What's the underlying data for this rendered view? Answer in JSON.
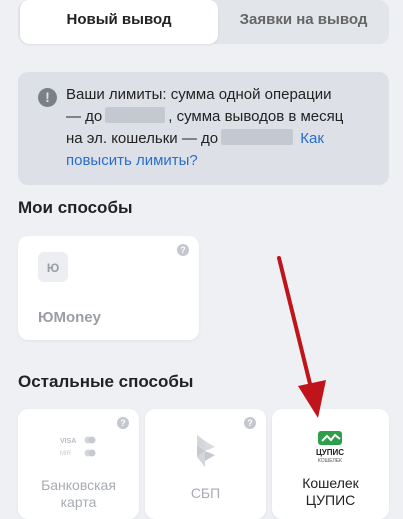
{
  "tabs": [
    {
      "label": "Новый вывод",
      "active": true
    },
    {
      "label": "Заявки на вывод",
      "active": false
    }
  ],
  "limits": {
    "icon": "info-icon",
    "line1": "Ваши лимиты: сумма одной операции",
    "line2_prefix": "— до",
    "line2_suffix": ", сумма выводов в месяц",
    "line3_prefix": "на эл. кошельки — до",
    "link_part1": "Как",
    "link_part2": "повысить лимиты?"
  },
  "my_methods": {
    "title": "Мои способы",
    "items": [
      {
        "label": "ЮMoney",
        "icon": "yumoney-logo-icon"
      }
    ]
  },
  "other_methods": {
    "title": "Остальные способы",
    "items": [
      {
        "label_line1": "Банковская",
        "label_line2": "карта",
        "icon": "visa-mir-cards-icon",
        "logo_text1": "VISA",
        "logo_text2": "MIR"
      },
      {
        "label": "СБП",
        "icon": "sbp-icon"
      },
      {
        "label_line1": "Кошелек",
        "label_line2": "ЦУПИС",
        "icon": "cupis-logo-icon",
        "logo_text1": "ЦУПИС",
        "logo_text2": "КОШЕЛЕК"
      }
    ]
  },
  "colors": {
    "background": "#eef0f4",
    "link": "#2a6ec7",
    "arrow": "#c0141b",
    "cupis_green": "#2e9e4a"
  }
}
